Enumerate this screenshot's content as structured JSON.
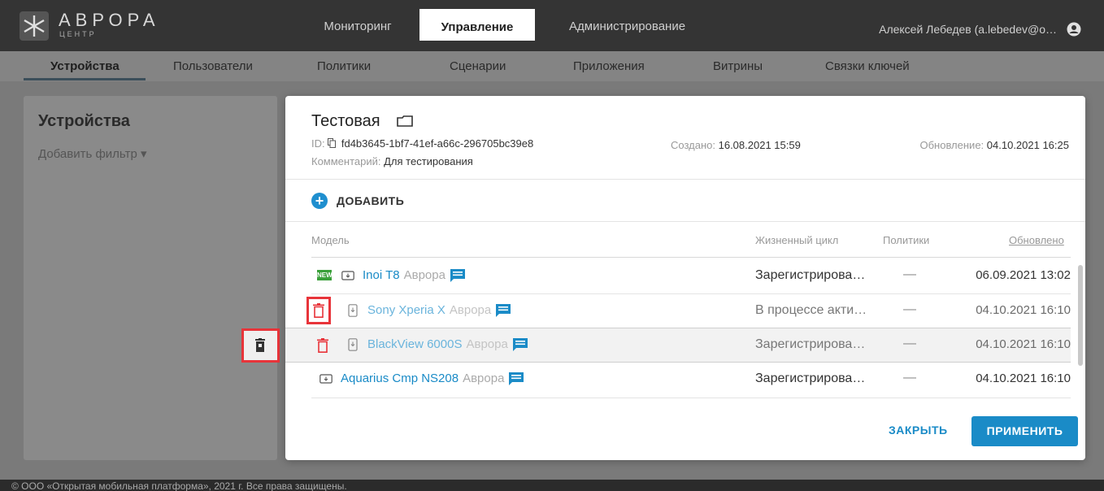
{
  "header": {
    "logo_text": "АВРОРА",
    "logo_sub": "ЦЕНТР",
    "tabs": [
      {
        "label": "Мониторинг"
      },
      {
        "label": "Управление"
      },
      {
        "label": "Администрирование"
      }
    ],
    "user": "Алексей Лебедев (a.lebedev@o…"
  },
  "subnav": {
    "tabs": [
      {
        "label": "Устройства"
      },
      {
        "label": "Пользователи"
      },
      {
        "label": "Политики"
      },
      {
        "label": "Сценарии"
      },
      {
        "label": "Приложения"
      },
      {
        "label": "Витрины"
      },
      {
        "label": "Связки ключей"
      }
    ]
  },
  "left": {
    "title": "Устройства",
    "filter": "Добавить фильтр ▾"
  },
  "modal": {
    "title": "Тестовая",
    "id_label": "ID: ",
    "id_value": "fd4b3645-1bf7-41ef-a66c-296705bc39e8",
    "comment_label": "Комментарий: ",
    "comment_value": "Для тестирования",
    "created_label": "Создано: ",
    "created_value": "16.08.2021 15:59",
    "updated_label": "Обновление: ",
    "updated_value": "04.10.2021 16:25",
    "add_label": "ДОБАВИТЬ",
    "columns": {
      "model": "Модель",
      "lifecycle": "Жизненный цикл",
      "policies": "Политики",
      "updated": "Обновлено"
    },
    "rows": [
      {
        "name": "Inoi T8",
        "vendor": "Аврора",
        "lifecycle": "Зарегистрирова…",
        "policies": "—",
        "updated": "06.09.2021 13:02",
        "badge": "NEW"
      },
      {
        "name": "Sony Xperia X",
        "vendor": "Аврора",
        "lifecycle": "В процессе акти…",
        "policies": "—",
        "updated": "04.10.2021 16:10"
      },
      {
        "name": "BlackView 6000S",
        "vendor": "Аврора",
        "lifecycle": "Зарегистрирова…",
        "policies": "—",
        "updated": "04.10.2021 16:10"
      },
      {
        "name": "Aquarius Cmp NS208",
        "vendor": "Аврора",
        "lifecycle": "Зарегистрирова…",
        "policies": "—",
        "updated": "04.10.2021 16:10"
      }
    ],
    "close_label": "ЗАКРЫТЬ",
    "apply_label": "ПРИМЕНИТЬ"
  },
  "footer": {
    "text": "© ООО «Открытая мобильная платформа», 2021 г. Все права защищены."
  },
  "colors": {
    "accent": "#1a8bc7",
    "danger": "#e8343a",
    "header_bg": "#343434",
    "new_badge": "#3aa03a"
  }
}
